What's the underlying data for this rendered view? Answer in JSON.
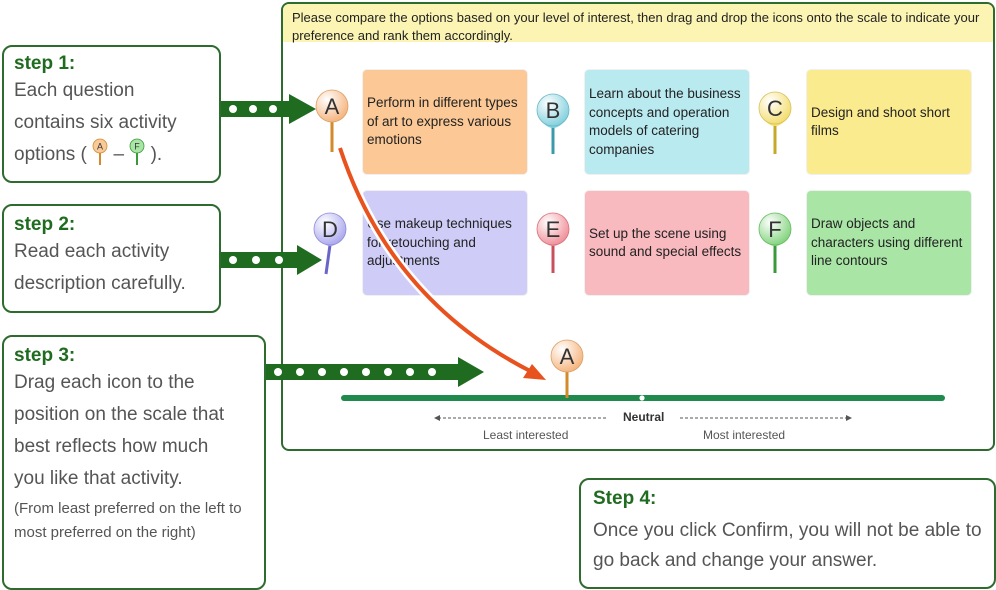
{
  "steps": {
    "s1": {
      "title": "step 1:",
      "lines": [
        "Each question",
        "contains six activity",
        "options ("
      ],
      "tail": ").",
      "dash": "–"
    },
    "s2": {
      "title": "step 2:",
      "lines": [
        "Read each activity",
        "description carefully."
      ]
    },
    "s3": {
      "title": "step 3:",
      "lines": [
        "Drag each icon to the",
        "position on the scale that",
        "best reflects how much",
        "you like that activity."
      ],
      "note": "(From least preferred on the left to most preferred on the right)"
    },
    "s4": {
      "title": "Step 4:",
      "text": "Once you click Confirm, you will not be able to go back and change your answer."
    }
  },
  "panel": {
    "instruction": "Please compare the options based on your level of interest, then drag and drop the icons onto the scale to indicate your preference and rank them accordingly."
  },
  "options": [
    {
      "letter": "A",
      "text": "Perform in different types of art to express various emotions",
      "card_color": "#fbc896",
      "pin_color": "#f5b27a"
    },
    {
      "letter": "B",
      "text": "Learn about the business concepts and operation models of catering companies",
      "card_color": "#b9eaf0",
      "pin_color": "#7fcfdc"
    },
    {
      "letter": "C",
      "text": "Design and shoot short films",
      "card_color": "#fbeb8f",
      "pin_color": "#f3dc6a"
    },
    {
      "letter": "D",
      "text": "Use makeup techniques for retouching and adjustments",
      "card_color": "#cfcdf8",
      "pin_color": "#a9a6ee"
    },
    {
      "letter": "E",
      "text": "Set up the scene using sound and special effects",
      "card_color": "#f8b9bf",
      "pin_color": "#f08c96"
    },
    {
      "letter": "F",
      "text": "Draw objects and characters using different line contours",
      "card_color": "#a9e6a6",
      "pin_color": "#7fd27a"
    }
  ],
  "scale": {
    "neutral": "Neutral",
    "least": "Least interested",
    "most": "Most interested",
    "placed_letter": "A"
  },
  "colors": {
    "accent": "#2e6b2e",
    "scale": "#1f8a4c",
    "arrow": "#e8521e"
  }
}
